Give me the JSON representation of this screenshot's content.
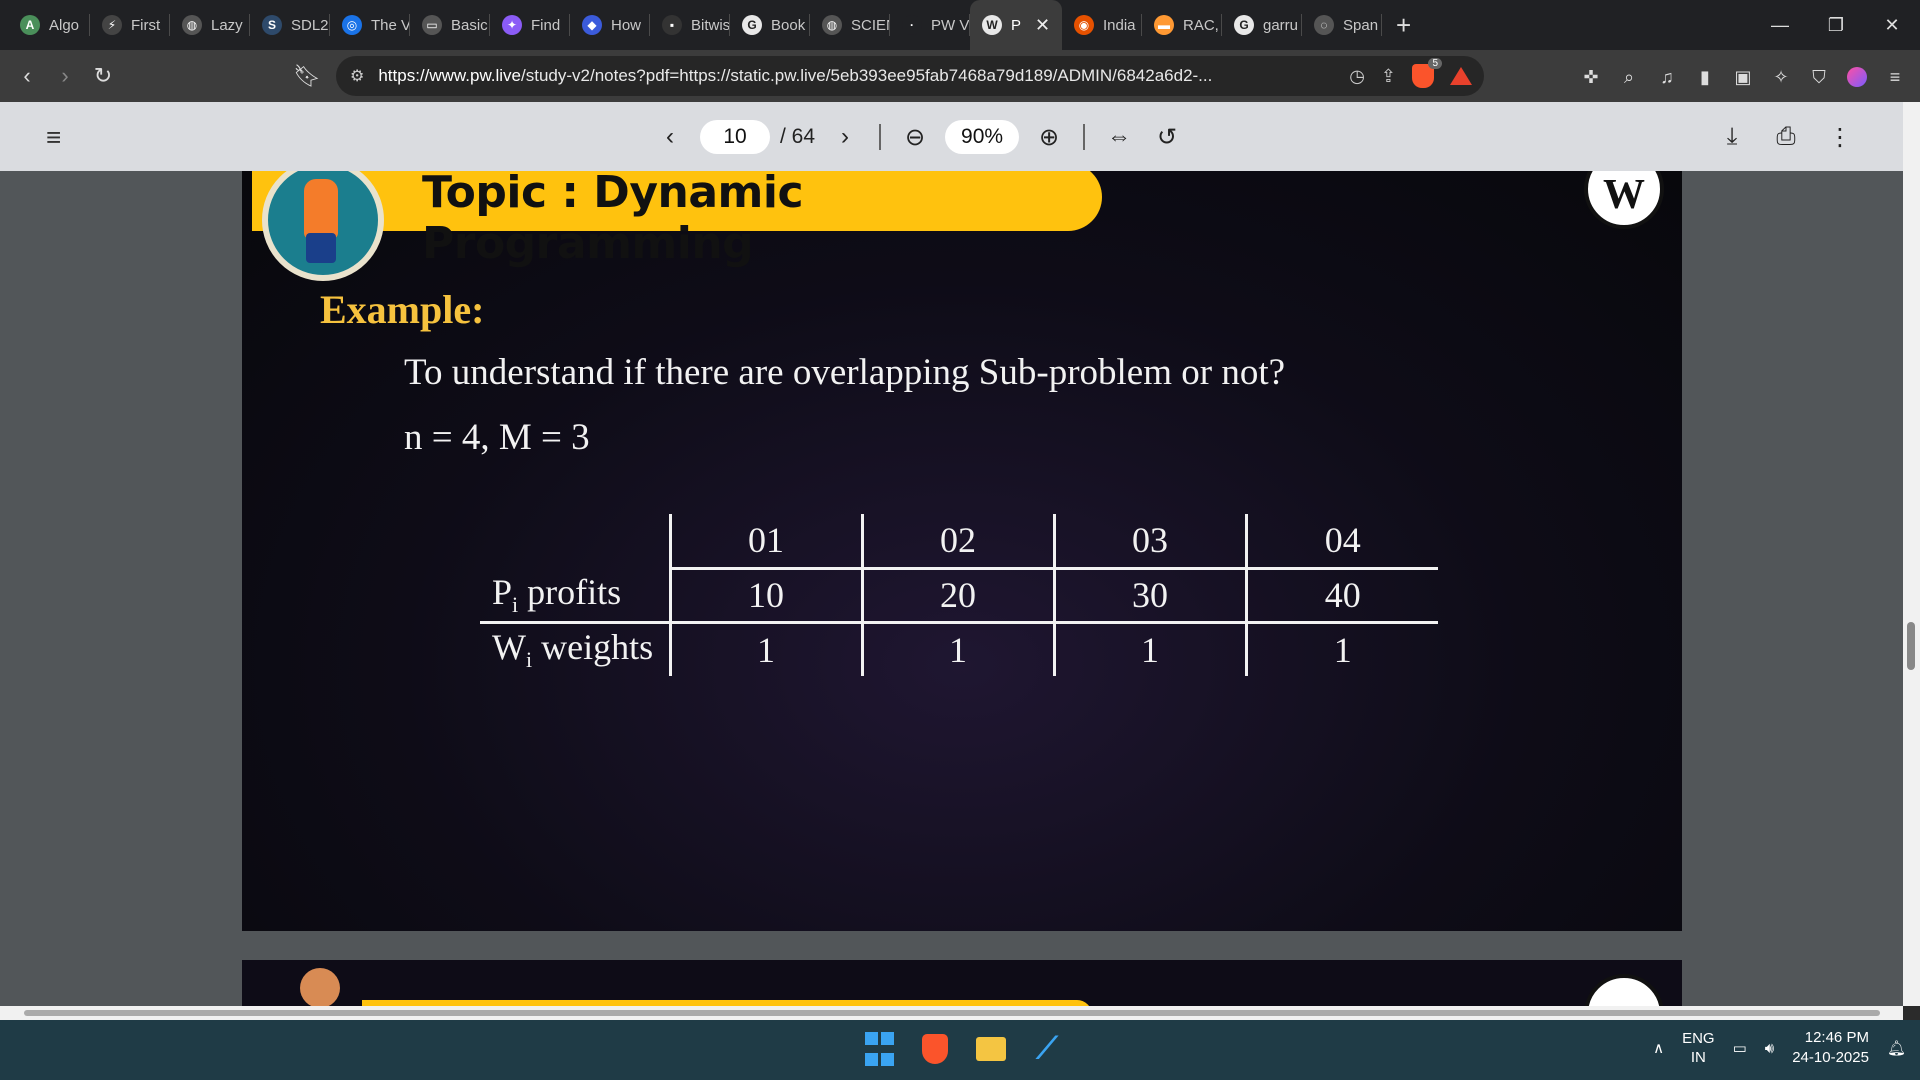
{
  "tabs": [
    {
      "label": "Algo",
      "color": "#4a8f5a",
      "icon": "A"
    },
    {
      "label": "First",
      "color": "#444444",
      "icon": "⚡"
    },
    {
      "label": "Lazy",
      "color": "#555555",
      "icon": "◍"
    },
    {
      "label": "SDL2",
      "color": "#2e4a6b",
      "icon": "S"
    },
    {
      "label": "The V",
      "color": "#1a73e8",
      "icon": "◎"
    },
    {
      "label": "Basic",
      "color": "#555555",
      "icon": "▭"
    },
    {
      "label": "Find",
      "color": "#8b5cf6",
      "icon": "✦"
    },
    {
      "label": "How",
      "color": "#3b5bdb",
      "icon": "◆"
    },
    {
      "label": "Bitwis",
      "color": "#333333",
      "icon": "▪"
    },
    {
      "label": "Book",
      "color": "#e8e8e8",
      "icon": "G"
    },
    {
      "label": "SCIEN",
      "color": "#555555",
      "icon": "◍"
    },
    {
      "label": "PW V",
      "color": "#202124",
      "icon": "·"
    },
    {
      "label": "P",
      "color": "#e8e8e8",
      "icon": "W",
      "active": true
    },
    {
      "label": "India",
      "color": "#e65100",
      "icon": "◉"
    },
    {
      "label": "RAC,",
      "color": "#ff9933",
      "icon": "▬"
    },
    {
      "label": "garru",
      "color": "#e8e8e8",
      "icon": "G"
    },
    {
      "label": "Span",
      "color": "#555555",
      "icon": "◌"
    }
  ],
  "address": {
    "url_host": "https://www.pw.live",
    "url_rest": "/study-v2/notes?pdf=https://static.pw.live/5eb393ee95fab7468a79d189/ADMIN/6842a6d2-...",
    "shield_badge": "5"
  },
  "pdf_toolbar": {
    "page_current": "10",
    "page_total": "/ 64",
    "zoom": "90%"
  },
  "slide": {
    "topic": "Topic : Dynamic Programming",
    "logo_letter": "W",
    "example_label": "Example:",
    "question": "To understand if there are overlapping Sub-problem or not?",
    "params": "n = 4, M = 3",
    "table": {
      "headers": [
        "01",
        "02",
        "03",
        "04"
      ],
      "profits_label_main": "P",
      "profits_label_sub": "i",
      "profits_label_rest": " profits",
      "profits": [
        "10",
        "20",
        "30",
        "40"
      ],
      "weights_label_main": "W",
      "weights_label_sub": "i",
      "weights_label_rest": " weights",
      "weights": [
        "1",
        "1",
        "1",
        "1"
      ]
    }
  },
  "taskbar": {
    "lang_top": "ENG",
    "lang_bottom": "IN",
    "time": "12:46 PM",
    "date": "24-10-2025"
  }
}
